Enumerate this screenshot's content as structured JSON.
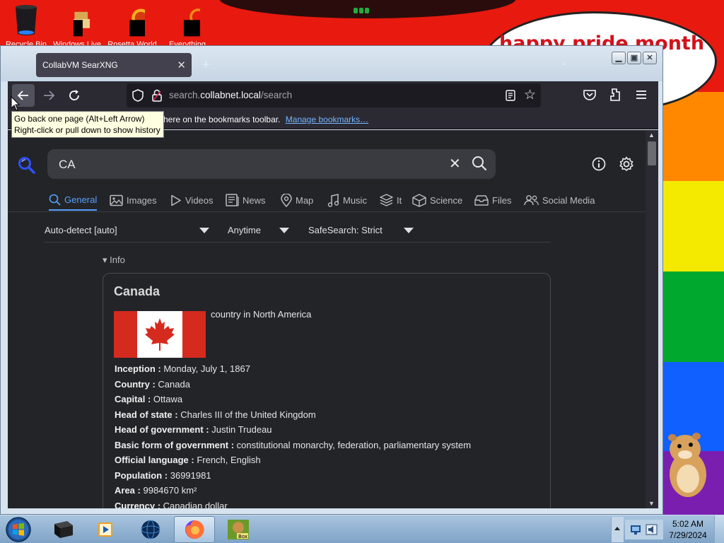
{
  "desktop": {
    "pride_text": "happy pride month",
    "stripe_colors": [
      "#ff8800",
      "#f4ea00",
      "#00a82d",
      "#1060ff",
      "#7a1eb0"
    ],
    "icons": [
      {
        "name": "recycle-bin",
        "label": "Recycle Bin"
      },
      {
        "name": "windows-live",
        "label": "Windows Live"
      },
      {
        "name": "rosetta-world",
        "label": "Rosetta World"
      },
      {
        "name": "something",
        "label": "Everything"
      }
    ]
  },
  "browser": {
    "tab_title": "CollabVM SearXNG",
    "url_host": "search.collabnet.local",
    "url_path": "/search",
    "bookmarks_text": "here on the bookmarks toolbar.",
    "bookmarks_link": "Manage bookmarks…",
    "tooltip_line1": "Go back one page (Alt+Left Arrow)",
    "tooltip_line2": "Right-click or pull down to show history"
  },
  "search": {
    "query": "CA",
    "categories": [
      "General",
      "Images",
      "Videos",
      "News",
      "Map",
      "Music",
      "It",
      "Science",
      "Files",
      "Social Media"
    ],
    "active_category": "General",
    "filters": {
      "language": "Auto-detect [auto]",
      "time": "Anytime",
      "safesearch": "SafeSearch: Strict"
    }
  },
  "infobox": {
    "toggle": "Info",
    "title": "Canada",
    "description": "country in North America",
    "attributes": [
      {
        "key": "Inception :",
        "value": "Monday, July 1, 1867"
      },
      {
        "key": "Country :",
        "value": "Canada"
      },
      {
        "key": "Capital :",
        "value": "Ottawa"
      },
      {
        "key": "Head of state :",
        "value": "Charles III of the United Kingdom"
      },
      {
        "key": "Head of government :",
        "value": "Justin Trudeau"
      },
      {
        "key": "Basic form of government :",
        "value": "constitutional monarchy, federation, parliamentary system"
      },
      {
        "key": "Official language :",
        "value": "French, English"
      },
      {
        "key": "Population :",
        "value": "36991981"
      },
      {
        "key": "Area :",
        "value": "9984670 km²"
      },
      {
        "key": "Currency :",
        "value": "Canadian dollar"
      }
    ]
  },
  "taskbar": {
    "time": "5:02 AM",
    "date": "7/29/2024"
  }
}
